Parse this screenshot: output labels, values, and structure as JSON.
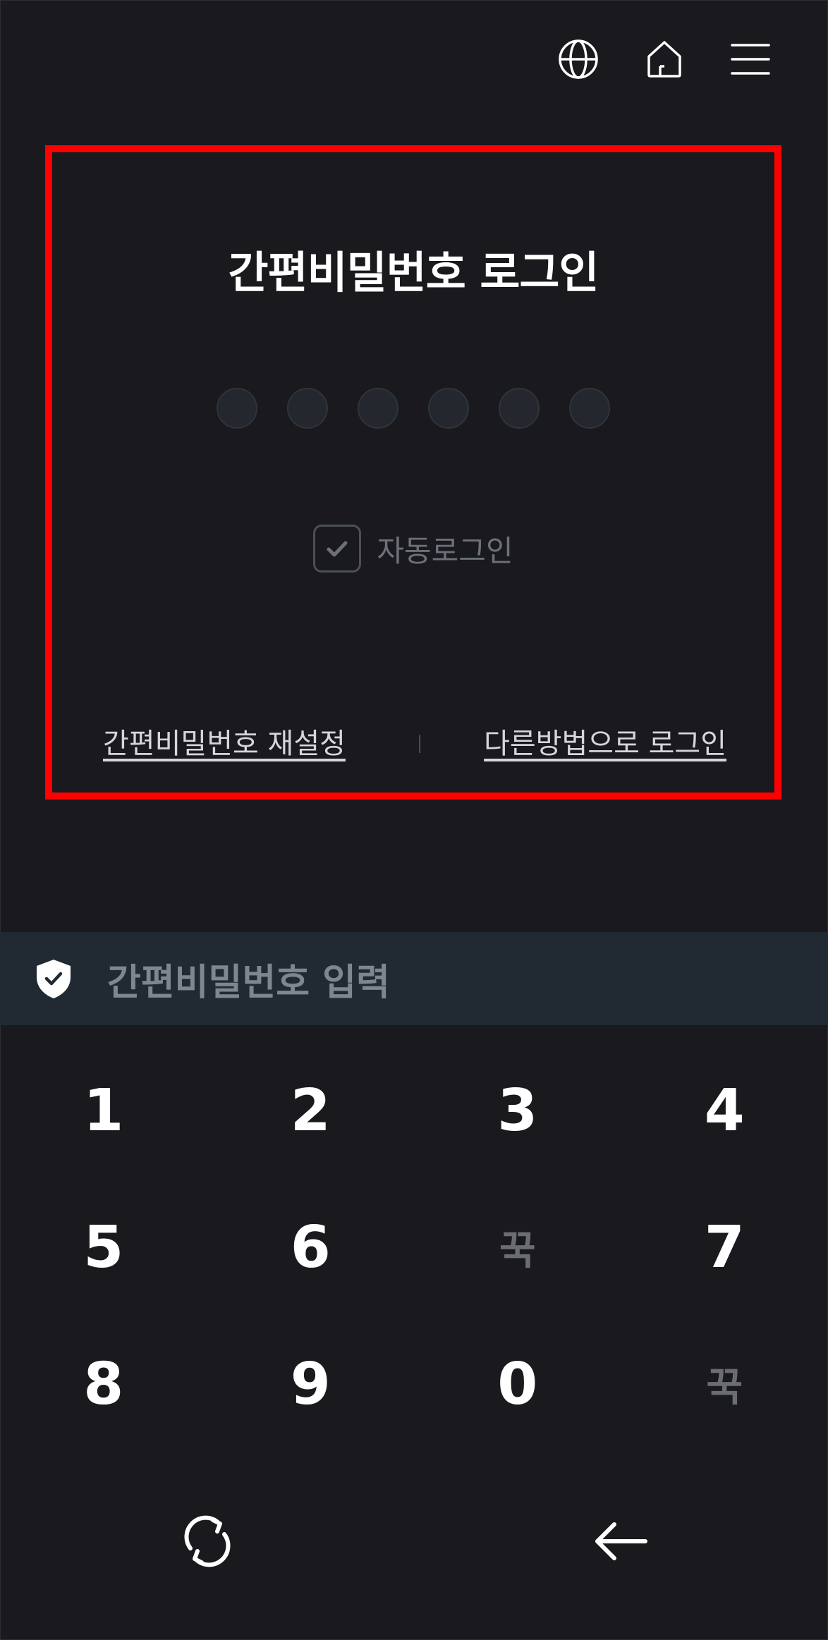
{
  "header": {
    "icons": [
      "globe-icon",
      "home-icon",
      "menu-icon"
    ]
  },
  "login": {
    "title": "간편비밀번호 로그인",
    "pin_length": 6,
    "auto_login_label": "자동로그인",
    "auto_login_checked": true,
    "reset_link": "간편비밀번호 재설정",
    "other_method_link": "다른방법으로 로그인"
  },
  "keypad": {
    "title": "간편비밀번호 입력",
    "rows": [
      [
        "1",
        "2",
        "3",
        "4"
      ],
      [
        "5",
        "6",
        "꾹",
        "7"
      ],
      [
        "8",
        "9",
        "0",
        "꾹"
      ]
    ],
    "actions": [
      "refresh-icon",
      "backspace-icon"
    ]
  },
  "colors": {
    "background": "#19191e",
    "highlight_border": "#ff0000",
    "keypad_header_bg": "#212a33"
  }
}
